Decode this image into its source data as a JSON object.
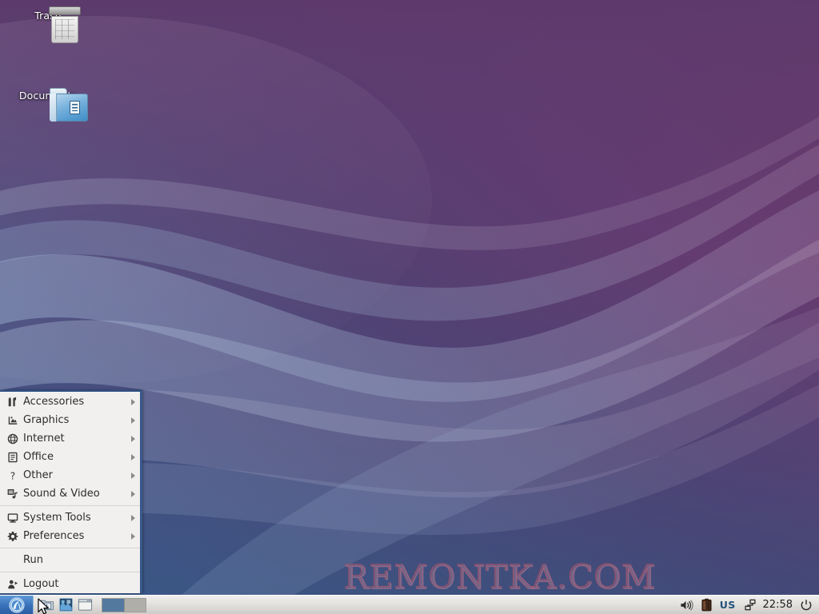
{
  "desktop": {
    "icons": [
      {
        "id": "trash",
        "label": "Trash",
        "icon": "trash-icon"
      },
      {
        "id": "documents",
        "label": "Documents",
        "icon": "folder-documents-icon"
      }
    ],
    "watermark": "REMONTKA.COM",
    "wallpaper": {
      "name": "abstract-wave-wallpaper",
      "purple": "#6b3d7a",
      "purple_dark": "#4a2f5c",
      "blue": "#3d6295",
      "blue_dark": "#2f4e7a",
      "magenta": "#7d3c66"
    }
  },
  "menu": {
    "name": "applications-menu",
    "groups": [
      {
        "items": [
          {
            "label": "Accessories",
            "icon": "accessories-icon",
            "submenu": true
          },
          {
            "label": "Graphics",
            "icon": "graphics-icon",
            "submenu": true
          },
          {
            "label": "Internet",
            "icon": "internet-globe-icon",
            "submenu": true
          },
          {
            "label": "Office",
            "icon": "office-document-icon",
            "submenu": true
          },
          {
            "label": "Other",
            "icon": "question-mark-icon",
            "submenu": true
          },
          {
            "label": "Sound & Video",
            "icon": "sound-video-icon",
            "submenu": true
          }
        ]
      },
      {
        "items": [
          {
            "label": "System Tools",
            "icon": "monitor-icon",
            "submenu": true
          },
          {
            "label": "Preferences",
            "icon": "gear-icon",
            "submenu": true
          }
        ]
      },
      {
        "items": [
          {
            "label": "Run",
            "icon": "",
            "submenu": false
          }
        ]
      },
      {
        "items": [
          {
            "label": "Logout",
            "icon": "logout-person-icon",
            "submenu": false
          }
        ]
      }
    ]
  },
  "taskbar": {
    "start_button": {
      "name": "applications-start-button",
      "icon": "xubuntu-mouse-logo"
    },
    "launchers": [
      {
        "name": "file-manager-launcher",
        "icon": "folder-icon"
      },
      {
        "name": "web-browser-launcher",
        "icon": "browser-icon"
      },
      {
        "name": "terminal-launcher",
        "icon": "terminal-window-icon"
      }
    ],
    "workspaces": [
      {
        "name": "workspace-1",
        "active": true
      },
      {
        "name": "workspace-2",
        "active": false
      }
    ],
    "tray": {
      "volume_icon": "speaker-volume-icon",
      "battery_icon": "battery-icon",
      "keyboard_layout": "US",
      "network_icon": "network-wired-icon",
      "clock": "22:58",
      "power_icon": "power-button-icon"
    }
  }
}
